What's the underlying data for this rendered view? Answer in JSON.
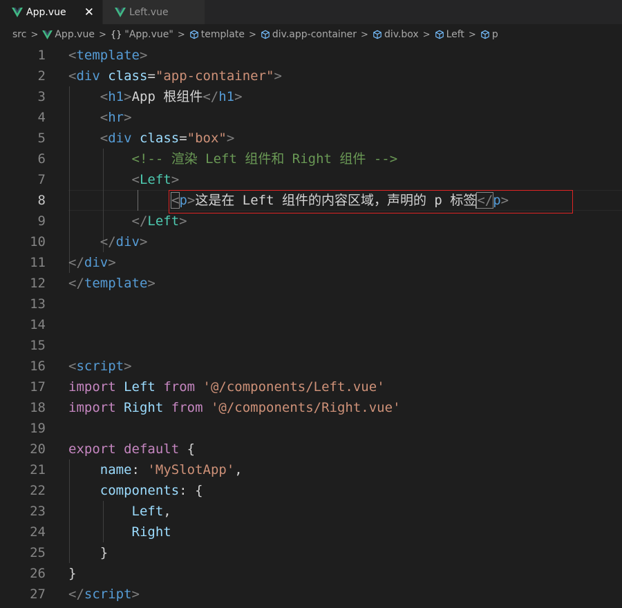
{
  "tabs": [
    {
      "label": "App.vue",
      "active": true,
      "close": "✕"
    },
    {
      "label": "Left.vue",
      "active": false
    }
  ],
  "breadcrumb": {
    "src": "src",
    "file": "App.vue",
    "object_icon": "{}",
    "object": "\"App.vue\"",
    "template": "template",
    "container": "div.app-container",
    "box": "div.box",
    "left": "Left",
    "p": "p"
  },
  "editor": {
    "current_line": 8,
    "line_numbers": [
      "1",
      "2",
      "3",
      "4",
      "5",
      "6",
      "7",
      "8",
      "9",
      "10",
      "11",
      "12",
      "13",
      "14",
      "15",
      "16",
      "17",
      "18",
      "19",
      "20",
      "21",
      "22",
      "23",
      "24",
      "25",
      "26",
      "27"
    ],
    "lines": {
      "l1": {
        "o": "<",
        "tag": "template",
        "c": ">"
      },
      "l2": {
        "o": "<",
        "tag": "div",
        "attr": "class",
        "eq": "=",
        "val": "\"app-container\"",
        "c": ">"
      },
      "l3": {
        "o": "<",
        "tag": "h1",
        "c": ">",
        "text": "App 根组件",
        "co": "</",
        "ctag": "h1",
        "cc": ">"
      },
      "l4": {
        "o": "<",
        "tag": "hr",
        "c": ">"
      },
      "l5": {
        "o": "<",
        "tag": "div",
        "attr": "class",
        "eq": "=",
        "val": "\"box\"",
        "c": ">"
      },
      "l6": {
        "comment": "<!-- 渲染 Left 组件和 Right 组件 -->"
      },
      "l7": {
        "o": "<",
        "tag": "Left",
        "c": ">"
      },
      "l8": {
        "o": "<",
        "tag": "p",
        "c": ">",
        "text": "这是在 Left 组件的内容区域，声明的 p 标签",
        "co": "</",
        "ctag": "p",
        "cc": ">"
      },
      "l9": {
        "o": "</",
        "tag": "Left",
        "c": ">"
      },
      "l10": {
        "o": "</",
        "tag": "div",
        "c": ">"
      },
      "l11": {
        "o": "</",
        "tag": "div",
        "c": ">"
      },
      "l12": {
        "o": "</",
        "tag": "template",
        "c": ">"
      },
      "l16": {
        "o": "<",
        "tag": "script",
        "c": ">"
      },
      "l17": {
        "kw": "import",
        "id": "Left",
        "from": "from",
        "str": "'@/components/Left.vue'"
      },
      "l18": {
        "kw": "import",
        "id": "Right",
        "from": "from",
        "str": "'@/components/Right.vue'"
      },
      "l20": {
        "kw": "export",
        "kw2": "default",
        "brace": "{"
      },
      "l21": {
        "key": "name",
        "colon": ":",
        "str": "'MySlotApp'",
        "comma": ","
      },
      "l22": {
        "key": "components",
        "colon": ":",
        "brace": "{"
      },
      "l23": {
        "id": "Left",
        "comma": ","
      },
      "l24": {
        "id": "Right"
      },
      "l25": {
        "brace": "}"
      },
      "l26": {
        "brace": "}"
      },
      "l27": {
        "o": "</",
        "tag": "script",
        "c": ">"
      }
    }
  },
  "colors": {
    "background": "#1e1e1e",
    "tag": "#569cd6",
    "component": "#4ec9b0",
    "attribute": "#9cdcfe",
    "string": "#ce9178",
    "comment": "#6a9955",
    "keyword": "#c586c0",
    "highlight_box": "#e02424"
  },
  "icons": {
    "vue": "vue-logo-icon",
    "close": "close-icon",
    "chevron": "chevron-right-icon",
    "symbol": "cube-symbol-icon",
    "object": "braces-icon"
  }
}
